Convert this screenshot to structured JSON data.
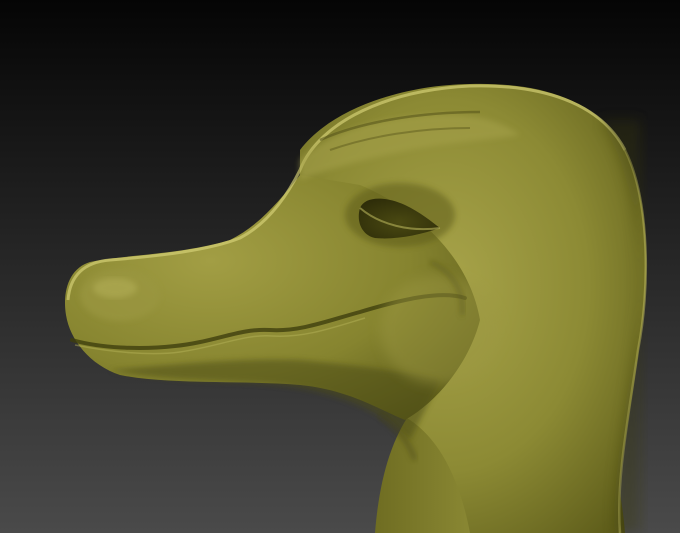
{
  "scene": {
    "subject": "sculpted-creature-head",
    "background_top": "#050505",
    "background_bottom": "#4a4a4a",
    "material_light": "#a6a248",
    "material_mid": "#8a8a32",
    "material_dark": "#4d4c15",
    "rim_light": "#d9d47a"
  }
}
